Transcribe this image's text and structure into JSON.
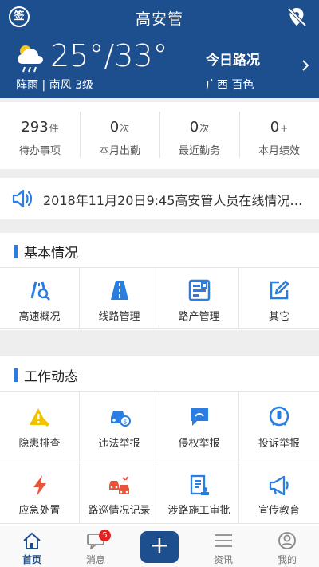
{
  "header": {
    "sign_label": "签",
    "title": "高安管",
    "weather": {
      "temp": "25°/33°",
      "desc": "阵雨 | 南风 3级"
    },
    "road_title": "今日路况",
    "region": "广西 百色"
  },
  "stats": [
    {
      "value": "293",
      "unit": "件",
      "label": "待办事项"
    },
    {
      "value": "0",
      "unit": "次",
      "label": "本月出勤"
    },
    {
      "value": "0",
      "unit": "次",
      "label": "最近勤务"
    },
    {
      "value": "0",
      "unit": "+",
      "label": "本月绩效"
    }
  ],
  "notice": {
    "text": "2018年11月20日9:45高安管人员在线情况…"
  },
  "basic": {
    "title": "基本情况",
    "items": [
      {
        "label": "高速概况",
        "icon": "highway-search-icon"
      },
      {
        "label": "线路管理",
        "icon": "road-icon"
      },
      {
        "label": "路产管理",
        "icon": "asset-icon"
      },
      {
        "label": "其它",
        "icon": "edit-icon"
      }
    ]
  },
  "work": {
    "title": "工作动态",
    "items": [
      {
        "label": "隐患排查",
        "icon": "warning-icon",
        "color": "#f2c100"
      },
      {
        "label": "违法举报",
        "icon": "car-report-icon",
        "color": "#2a7de1"
      },
      {
        "label": "侵权举报",
        "icon": "chat-icon",
        "color": "#2a7de1"
      },
      {
        "label": "投诉举报",
        "icon": "complaint-icon",
        "color": "#2a7de1"
      },
      {
        "label": "应急处置",
        "icon": "lightning-icon",
        "color": "#e8543a"
      },
      {
        "label": "路巡情况记录",
        "icon": "patrol-cars-icon",
        "color": "#e8543a"
      },
      {
        "label": "涉路施工审批",
        "icon": "document-stamp-icon",
        "color": "#2a7de1"
      },
      {
        "label": "宣传教育",
        "icon": "megaphone-icon",
        "color": "#2a7de1"
      }
    ]
  },
  "tabbar": {
    "items": [
      {
        "label": "首页"
      },
      {
        "label": "消息",
        "badge": "5"
      },
      {
        "label": "资讯"
      },
      {
        "label": "我的"
      }
    ],
    "plus_label": "+"
  },
  "colors": {
    "brand": "#1d4f8e",
    "accent": "#2a7de1",
    "badge": "#e02424"
  }
}
